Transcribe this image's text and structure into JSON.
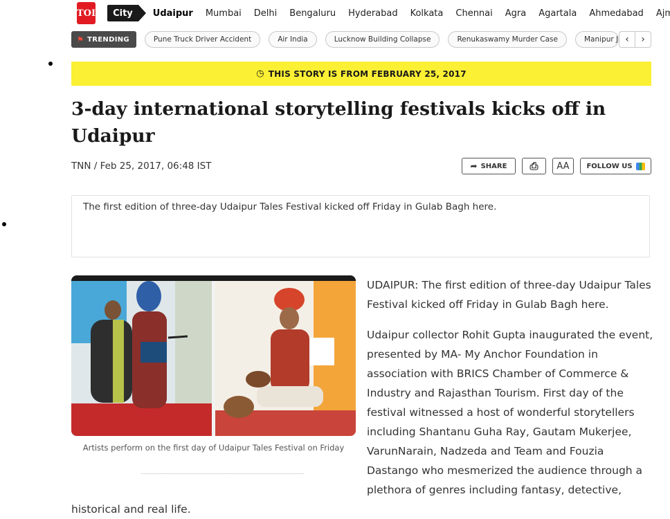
{
  "nav": {
    "logo": "TOI",
    "section": "City",
    "cities": [
      "Udaipur",
      "Mumbai",
      "Delhi",
      "Bengaluru",
      "Hyderabad",
      "Kolkata",
      "Chennai",
      "Agra",
      "Agartala",
      "Ahmedabad",
      "Ajmer"
    ],
    "active_city": "Udaipur"
  },
  "trending": {
    "label": "TRENDING",
    "items": [
      "Pune Truck Driver Accident",
      "Air India",
      "Lucknow Building Collapse",
      "Renukaswamy Murder Case",
      "Manipur Jir"
    ],
    "prev": "‹",
    "next": "›"
  },
  "banner": {
    "text": "THIS STORY IS FROM FEBRUARY 25, 2017"
  },
  "article": {
    "headline": "3-day international storytelling festivals kicks off in Udaipur",
    "byline": "TNN / Feb 25, 2017, 06:48 IST",
    "summary": "The first edition of three-day Udaipur Tales Festival kicked off Friday in Gulab Bagh here.",
    "caption": "Artists perform on the first day of Udaipur Tales Festival on Friday",
    "paragraphs": [
      "UDAIPUR: The first edition of three-day Udaipur Tales Festival kicked off Friday in Gulab Bagh here.",
      "Udaipur collector Rohit Gupta inaugurated the event, presented by MA- My Anchor Foundation in association with BRICS Chamber of Commerce & Industry and Rajasthan Tourism. First day of the festival witnessed a host of wonderful storytellers including Shantanu Guha Ray, Gautam Mukerjee, VarunNarain, Nadzeda and Team and Fouzia Dastango who mesmerized the audience through a plethora of genres including fantasy, detective,"
    ],
    "tail": "historical and real life."
  },
  "actions": {
    "share": "SHARE",
    "print_icon": "printer-icon",
    "font_size": "AA",
    "follow": "FOLLOW US"
  },
  "colors": {
    "brand_red": "#e21b22",
    "banner_yellow": "#fbf034",
    "nav_dark": "#1a1a1a"
  }
}
